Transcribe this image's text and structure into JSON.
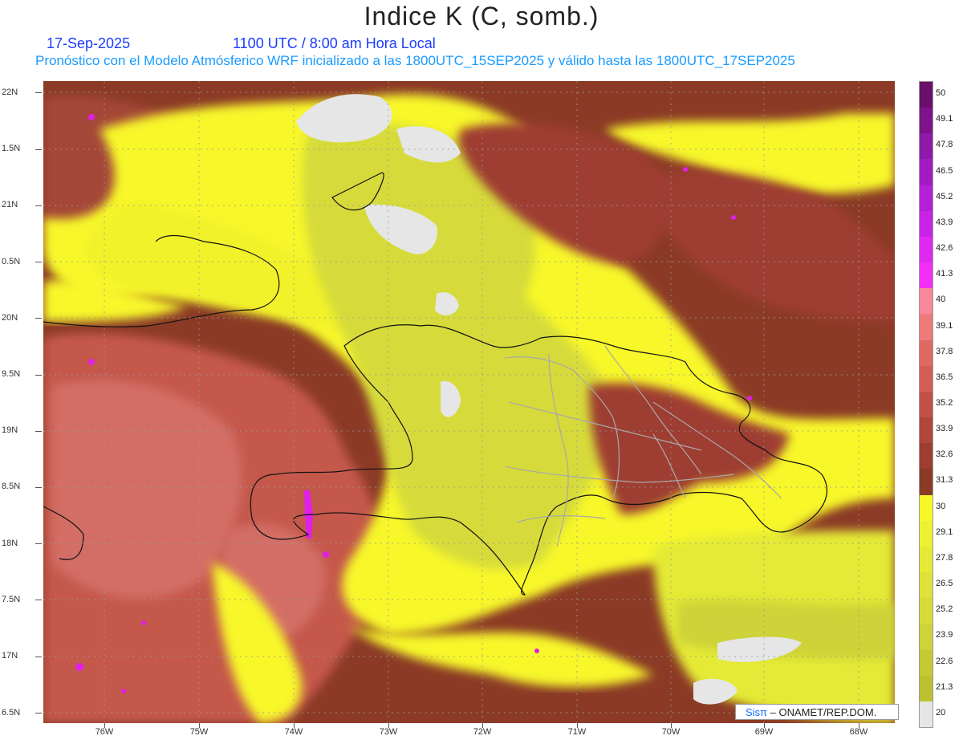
{
  "title": "Indice K (C, somb.)",
  "date": "17-Sep-2025",
  "time": "1100 UTC / 8:00 am Hora Local",
  "subtitle": "Pronóstico con el Modelo Atmósferico WRF inicializado a las 1800UTC_15SEP2025 y válido hasta las  1800UTC_17SEP2025",
  "y_labels": [
    "22N",
    "1.5N",
    "21N",
    "0.5N",
    "20N",
    "9.5N",
    "19N",
    "8.5N",
    "18N",
    "7.5N",
    "17N",
    "6.5N"
  ],
  "x_labels": [
    "76W",
    "75W",
    "74W",
    "73W",
    "72W",
    "71W",
    "70W",
    "69W",
    "68W"
  ],
  "legend": {
    "labels": [
      "50",
      "49.1",
      "47.8",
      "46.5",
      "45.2",
      "43.9",
      "42.6",
      "41.3",
      "40",
      "39.1",
      "37.8",
      "36.5",
      "35.2",
      "33.9",
      "32.6",
      "31.3",
      "30",
      "29.1",
      "27.8",
      "26.5",
      "25.2",
      "23.9",
      "22.6",
      "21.3",
      "20"
    ],
    "colors": [
      "#6a0f6a",
      "#7d1489",
      "#8f19a8",
      "#a01cc2",
      "#b51fd6",
      "#c824e6",
      "#de2af0",
      "#f22ef7",
      "#f6899a",
      "#ee7a7a",
      "#e06a62",
      "#d45e55",
      "#c45148",
      "#b0463c",
      "#9e3d31",
      "#8b3a26",
      "#f7f72a",
      "#eef033",
      "#e4ea35",
      "#dde13a",
      "#d6db3a",
      "#cdd339",
      "#c5ca34",
      "#bcc22f",
      "#e6e6e6"
    ]
  },
  "credit": {
    "sis": "Sisπ",
    "rest": "– ONAMET/REP.DOM."
  },
  "colors": {
    "dark_brown": "#8b3a26",
    "brown": "#9e3d31",
    "pink": "#d06a60",
    "yellow": "#f7f72a",
    "olive": "#d8de3b",
    "grey": "#e6e6e6",
    "magenta": "#e020e8"
  }
}
